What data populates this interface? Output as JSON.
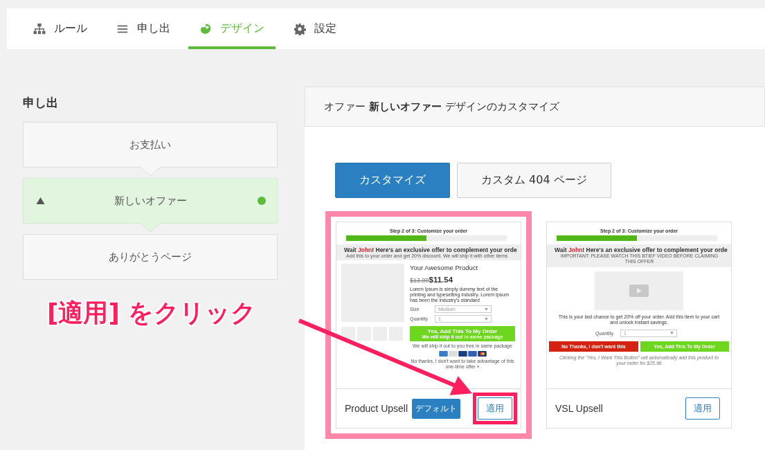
{
  "tabs": [
    {
      "label": "ルール",
      "selected": false
    },
    {
      "label": "申し出",
      "selected": false
    },
    {
      "label": "デザイン",
      "selected": true
    },
    {
      "label": "設定",
      "selected": false
    }
  ],
  "sidebar": {
    "title": "申し出",
    "items": [
      {
        "label": "お支払い",
        "selected": false
      },
      {
        "label": "新しいオファー",
        "selected": true
      },
      {
        "label": "ありがとうページ",
        "selected": false
      }
    ]
  },
  "panel": {
    "title_pre": "オファー",
    "title_bold": "新しいオファー",
    "title_post": "デザインのカスタマイズ",
    "buttons": [
      {
        "label": "カスタマイズ",
        "selected": true
      },
      {
        "label": "カスタム 404 ページ",
        "selected": false
      }
    ],
    "templates": [
      {
        "kind": "product",
        "name": "Product Upsell",
        "default_label": "デフォルト",
        "apply_label": "適用",
        "highlighted": true,
        "step": "Step 2 of 3: Customize your order",
        "level": 0.5,
        "wait": "Wait",
        "customer": "John",
        "headline": "! Here's an exclusive offer to complement your orde",
        "subline": "Add this to your order and get 20% discount. We will ship it with other items",
        "product": "Your Awesome Product",
        "old_price": "$13.00",
        "price": "$11.54",
        "description": "Lorem Ipsum is simply dummy text of the printing and typesetting industry. Lorem Ipsum has been the industry's standard",
        "fields": [
          {
            "label": "Size",
            "value": "Medium"
          },
          {
            "label": "Quantity",
            "value": "1"
          }
        ],
        "yes": "Yes, Add This To My Order",
        "yes_sub": "We will ship it out in same package",
        "shipping": "We will ship it out to you free in same package",
        "decline": "No thanks, I don't want to take advantage of this one-time offer »"
      },
      {
        "kind": "video",
        "name": "VSL Upsell",
        "apply_label": "適用",
        "highlighted": false,
        "step": "Step 2 of 3: Customize your order",
        "level": 0.5,
        "wait": "Wait",
        "customer": "John",
        "headline": "! Here's an exclusive offer to complement your orde",
        "subline": "IMPORTANT: PLEASE WATCH THIS BTIEF VIDEO BEFORE CLAIMING THIS OFFER",
        "description": "This is your last chance to get 20% off your order. Add this item to your cart and unlock instant savings.",
        "fields": [
          {
            "label": "Quantity",
            "value": "1"
          }
        ],
        "no": "No Thanks, I don't want this",
        "yes": "Yes, Add This To My Order",
        "footnote": "Clicking the \"Yes, I Want This Button\" will automatically add this product to your order for $25.96"
      }
    ]
  },
  "annotation": {
    "text": "[適用] をクリック"
  }
}
